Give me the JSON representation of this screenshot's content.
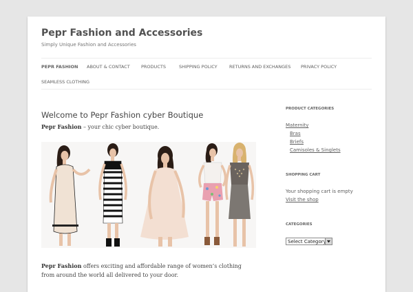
{
  "site": {
    "title": "Pepr Fashion and Accessories",
    "tagline": "Simply Unique Fashion and Accessories"
  },
  "nav": {
    "items": [
      {
        "label": "PEPR FASHION"
      },
      {
        "label": "ABOUT & CONTACT"
      },
      {
        "label": "PRODUCTS"
      },
      {
        "label": "SHIPPING POLICY"
      },
      {
        "label": "RETURNS AND EXCHANGES"
      },
      {
        "label": "PRIVACY POLICY"
      },
      {
        "label": "SEAMLESS CLOTHING"
      }
    ]
  },
  "main": {
    "title": "Welcome to Pepr Fashion cyber Boutique",
    "intro_bold": "Pepr Fashion",
    "intro_rest": " – your chic cyber boutique.",
    "para_bold": "Pepr Fashion",
    "para_rest": " offers exciting and affordable range of women’s clothing from around the world all delivered to your door."
  },
  "sidebar": {
    "product_categories": {
      "title": "PRODUCT CATEGORIES",
      "items": [
        {
          "label": "Maternity"
        },
        {
          "label": "Bras"
        },
        {
          "label": "Briefs"
        },
        {
          "label": "Camisoles & Singlets"
        }
      ]
    },
    "cart": {
      "title": "SHOPPING CART",
      "empty_text": "Your shopping cart is empty",
      "link": "Visit the shop"
    },
    "categories": {
      "title": "CATEGORIES",
      "select_value": "Select Category"
    }
  },
  "colors": {
    "page_bg": "#e6e6e6",
    "content_bg": "#ffffff",
    "text": "#444444",
    "link": "#5e5e5e"
  }
}
